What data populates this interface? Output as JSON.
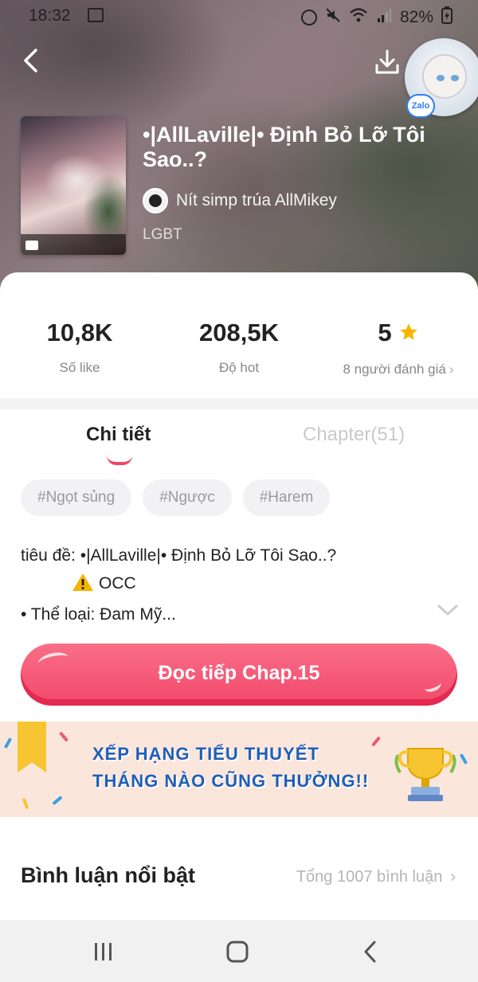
{
  "status_bar": {
    "time": "18:32",
    "battery": "82%"
  },
  "header": {
    "back_icon": "chevron-left-icon",
    "download_icon": "download-icon",
    "zalo_badge": "Zalo"
  },
  "story": {
    "title": "•|AllLaville|• Định Bỏ Lỡ Tôi Sao..?",
    "author": "Nít simp trúa AllMikey",
    "genre": "LGBT"
  },
  "stats": [
    {
      "value": "10,8K",
      "label": "Số like"
    },
    {
      "value": "208,5K",
      "label": "Độ hot"
    },
    {
      "value": "5",
      "label": "8 người đánh giá"
    }
  ],
  "tabs": {
    "details": "Chi tiết",
    "chapters": "Chapter(51)"
  },
  "tags": [
    "#Ngọt sủng",
    "#Ngược",
    "#Harem"
  ],
  "description": {
    "line1": "tiêu đề: •|AllLaville|• Định Bỏ Lỡ Tôi Sao..?",
    "line2": "OCC",
    "line3": "• Thể loại: Đam Mỹ..."
  },
  "read_button": "Đọc tiếp Chap.15",
  "banner": {
    "line1": "XẾP HẠNG TIỂU THUYẾT",
    "line2": "THÁNG NÀO CŨNG THƯỞNG!!"
  },
  "comments": {
    "title": "Bình luận nổi bật",
    "total": "Tổng 1007 bình luận"
  },
  "colors": {
    "accent": "#f2486a",
    "banner_text": "#1e5fb8",
    "star": "#f7b500"
  }
}
